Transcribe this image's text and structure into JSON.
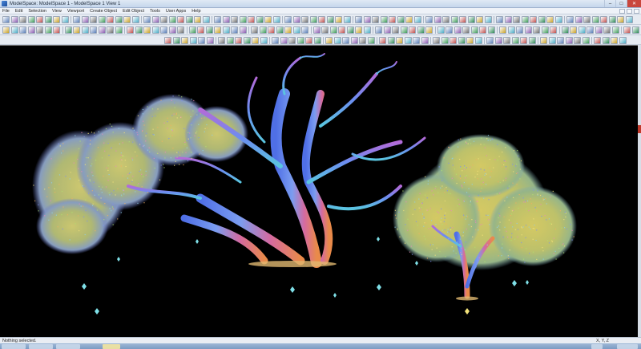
{
  "window": {
    "title": "ModelSpace: ModelSpace 1 - ModelSpace 1 View 1",
    "minimize": "–",
    "maximize": "□",
    "close": "✕"
  },
  "menu": {
    "items": [
      "File",
      "Edit",
      "Selection",
      "View",
      "Viewport",
      "Create Object",
      "Edit Object",
      "Tools",
      "User Apps",
      "Help"
    ]
  },
  "status": {
    "message": "Nothing selected.",
    "coords": "X, Y, Z"
  },
  "colors": {
    "background": "#000000",
    "accent": "#1b4d9c",
    "foliage": "#c9c96a",
    "trunk": "#5a7fe0"
  },
  "icons": [
    "select-icon",
    "pan-icon",
    "zoom-icon",
    "rotate-icon",
    "fit-icon",
    "measure-icon",
    "fence-icon",
    "layer-icon",
    "render-icon",
    "settings-icon"
  ]
}
